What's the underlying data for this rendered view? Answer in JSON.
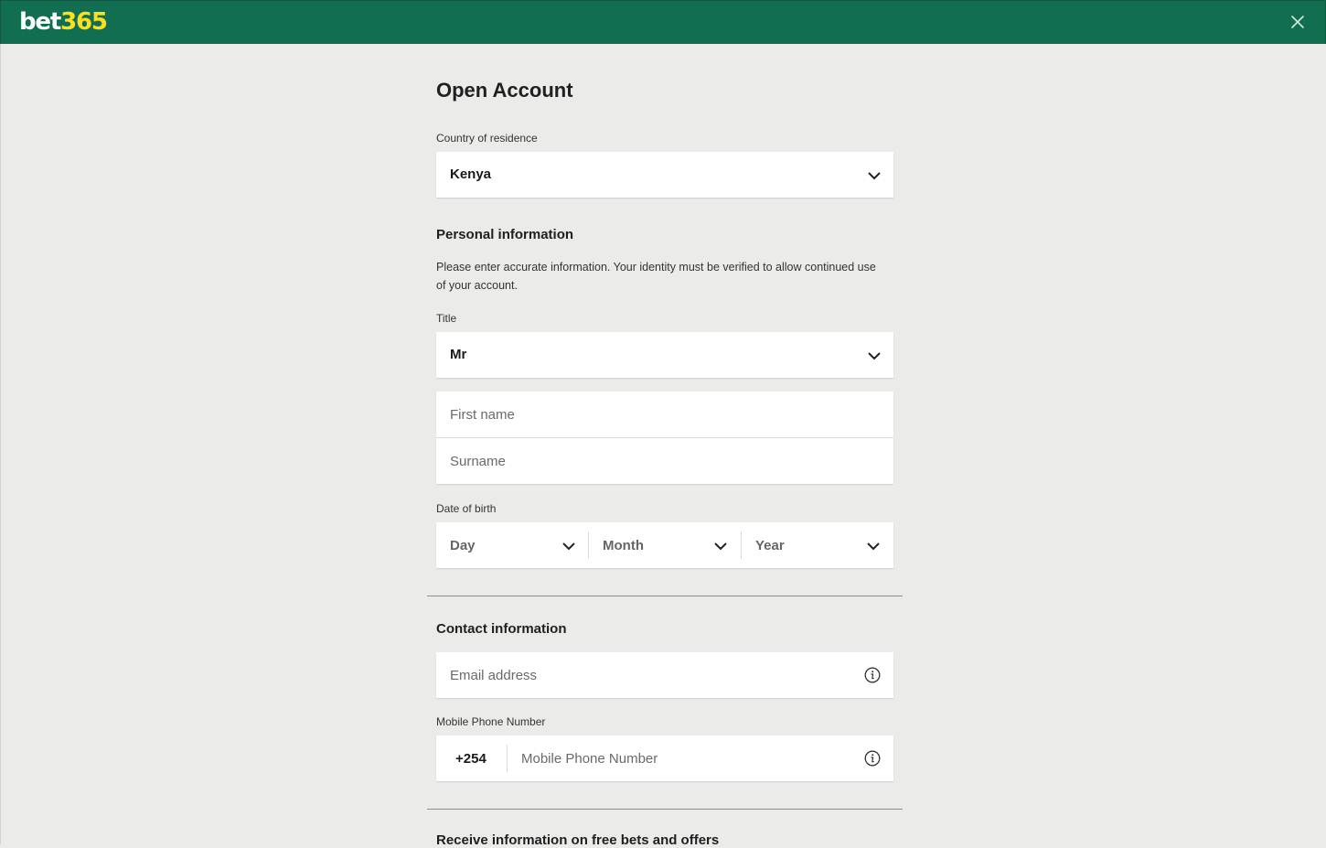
{
  "brand": {
    "logo_part1": "bet",
    "logo_part2": "365",
    "header_color": "#126e51",
    "accent_yellow": "#ffdf1b"
  },
  "header": {
    "close_icon": "close-icon"
  },
  "form": {
    "title": "Open Account",
    "country": {
      "label": "Country of residence",
      "value": "Kenya"
    },
    "personal": {
      "heading": "Personal information",
      "helper": "Please enter accurate information. Your identity must be verified to allow continued use of your account.",
      "title_label": "Title",
      "title_value": "Mr",
      "first_name_placeholder": "First name",
      "surname_placeholder": "Surname",
      "dob_label": "Date of birth",
      "dob_day": "Day",
      "dob_month": "Month",
      "dob_year": "Year"
    },
    "contact": {
      "heading": "Contact information",
      "email_placeholder": "Email address",
      "mobile_label": "Mobile Phone Number",
      "mobile_prefix": "+254",
      "mobile_placeholder": "Mobile Phone Number"
    },
    "offers": {
      "heading": "Receive information on free bets and offers"
    }
  }
}
